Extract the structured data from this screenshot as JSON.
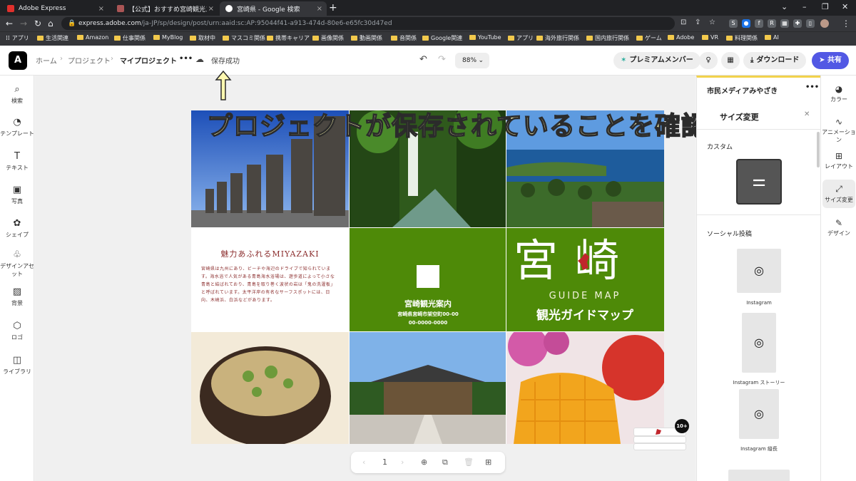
{
  "browser": {
    "tabs": [
      {
        "label": "Adobe Express",
        "active": false
      },
      {
        "label": "【公式】おすすめ宮崎観光スポット/...",
        "active": false
      },
      {
        "label": "宮崎県 - Google 検索",
        "active": true
      }
    ],
    "url_main": "express.adobe.com",
    "url_rest": "/ja-JP/sp/design/post/urn:aaid:sc:AP:95044f41-a913-474d-80e6-e65fc30d47ed",
    "bookmarks": [
      "アプリ",
      "生活関連",
      "Amazon",
      "仕事関係",
      "MyBlog",
      "取材中",
      "マスコミ関係",
      "携帯キャリア",
      "画像関係",
      "動画関係",
      "音関係",
      "Google関連",
      "YouTube",
      "アプリ",
      "海外旅行関係",
      "国内旅行関係",
      "ゲーム",
      "Adobe",
      "VR",
      "料理関係",
      "AI"
    ]
  },
  "header": {
    "breadcrumb_home": "ホーム",
    "breadcrumb_project": "プロジェクト",
    "breadcrumb_my": "マイプロジェクト",
    "more": "•••",
    "save_status": "保存成功",
    "zoom": "88%",
    "premium": "プレミアムメンバー",
    "download": "ダウンロード",
    "share": "共有"
  },
  "left_tools": [
    {
      "icon": "search-icon",
      "glyph": "⌕",
      "label": "検索"
    },
    {
      "icon": "template-icon",
      "glyph": "◔",
      "label": "テンプレート"
    },
    {
      "icon": "text-icon",
      "glyph": "T",
      "label": "テキスト"
    },
    {
      "icon": "photo-icon",
      "glyph": "▣",
      "label": "写真"
    },
    {
      "icon": "shape-icon",
      "glyph": "✿",
      "label": "シェイプ"
    },
    {
      "icon": "design-asset-icon",
      "glyph": "♧",
      "label": "デザインアセット"
    },
    {
      "icon": "background-icon",
      "glyph": "▨",
      "label": "背景"
    },
    {
      "icon": "logo-icon",
      "glyph": "⬡",
      "label": "ロゴ"
    },
    {
      "icon": "library-icon",
      "glyph": "◫",
      "label": "ライブラリ"
    }
  ],
  "design": {
    "text_title": "魅力あふれるMIYAZAKI",
    "text_body": "宮崎県は九州にあり、ビーチや海辺のドライブで知られています。海水浴で人気がある青島海水浴場は、遊歩道によって小さな青島と結ばれており、青島を取り巻く波状の岩は「鬼の洗濯板」と呼ばれています。太平洋岸の有名なサーフスポットには、日向、木崎浜、白浜などがあります。",
    "guide_title": "宮崎観光案内",
    "guide_address": "宮崎県宮崎市架空町00-00",
    "guide_phone": "00-0000-0000",
    "big_title": "宮崎",
    "guide_map_en": "GUIDE MAP",
    "guide_map_jp": "観光ガイドマップ"
  },
  "annotation": "プロジェクトが保存されていることを確認",
  "pager": {
    "page": "1",
    "badge": "10+"
  },
  "panel": {
    "brand": "市民メディアみやざき",
    "more": "•••",
    "title": "サイズ変更",
    "custom_label": "カスタム",
    "social_label": "ソーシャル投稿",
    "items": [
      "Instagram",
      "Instagram ストーリー",
      "Instagram 縦長"
    ]
  },
  "right_tools": [
    {
      "icon": "color-icon",
      "glyph": "◕",
      "label": "カラー"
    },
    {
      "icon": "animation-icon",
      "glyph": "∿",
      "label": "アニメーション"
    },
    {
      "icon": "layout-icon",
      "glyph": "⊞",
      "label": "レイアウト"
    },
    {
      "icon": "resize-icon",
      "glyph": "⤢",
      "label": "サイズ変更"
    },
    {
      "icon": "design-icon",
      "glyph": "✎",
      "label": "デザイン"
    }
  ],
  "colors": {
    "accent": "#5258e4",
    "green": "#4e8a08",
    "annotation_fill": "#fff8b0"
  }
}
